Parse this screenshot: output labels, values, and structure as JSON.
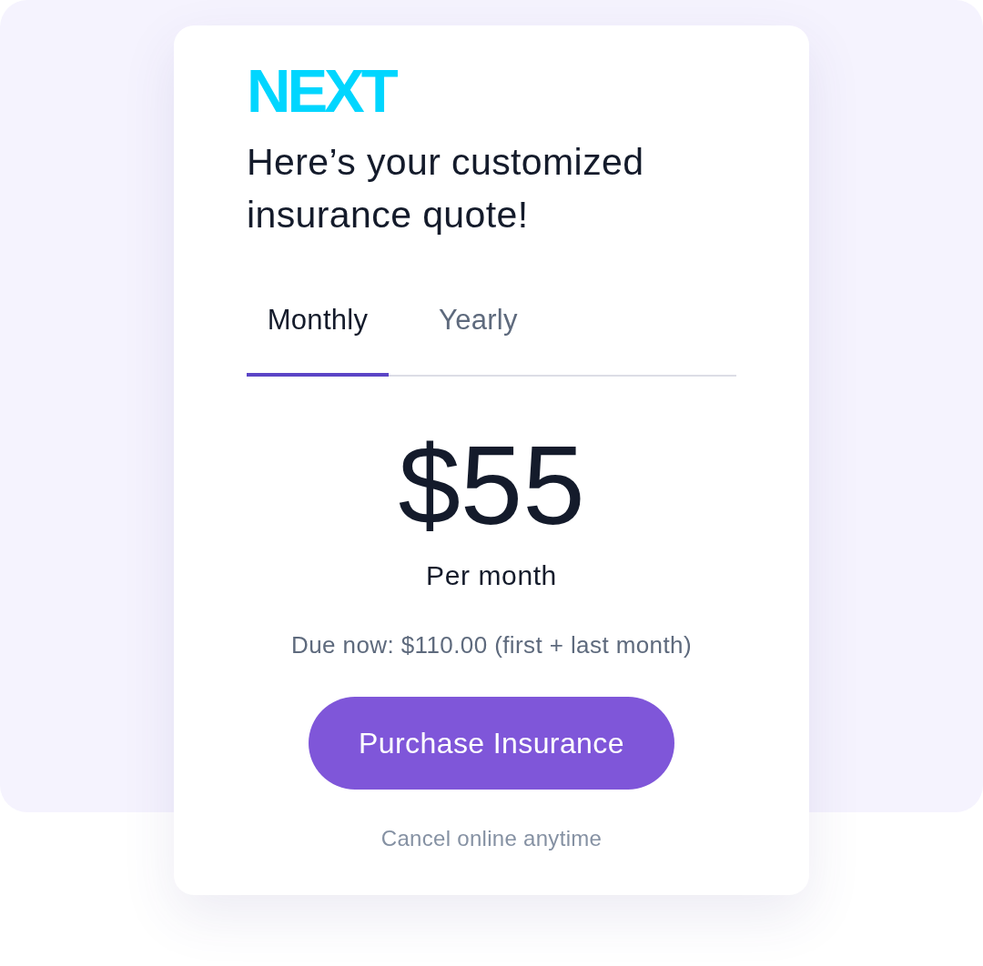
{
  "logo": {
    "text": "NEXT"
  },
  "heading": "Here’s your customized insurance quote!",
  "tabs": [
    {
      "label": "Monthly",
      "selected": true
    },
    {
      "label": "Yearly",
      "selected": false
    }
  ],
  "price": {
    "amount": "$55",
    "period": "Per month"
  },
  "due_note": "Due now: $110.00 (first + last month)",
  "purchase_button": {
    "label": "Purchase Insurance"
  },
  "footer_note": "Cancel online anytime"
}
